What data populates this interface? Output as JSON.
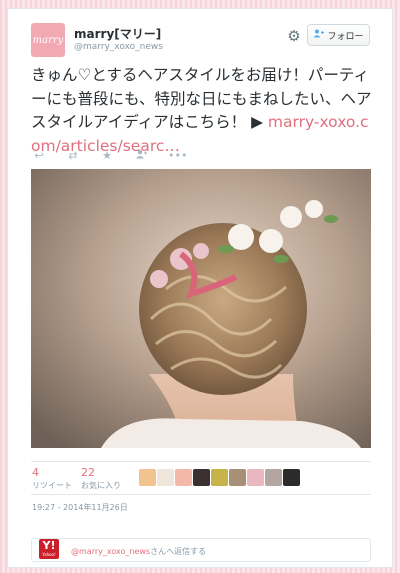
{
  "user": {
    "display_name": "marry[マリー]",
    "handle": "@marry_xoxo_news",
    "avatar_text": "marry"
  },
  "follow_button": {
    "label": "フォロー",
    "icon": "person-plus-icon"
  },
  "tweet": {
    "text": "きゅん♡とするヘアスタイルをお届け！パーティーにも普段にも、特別な日にもまねしたい、ヘアスタイルアイディアはこちら！ ▶ ",
    "link": "marry-xoxo.com/articles/searc…"
  },
  "actions": [
    "reply-icon",
    "retweet-icon",
    "favorite-icon",
    "follow-icon",
    "more-icon"
  ],
  "stats": {
    "retweets": {
      "count": "4",
      "label": "リツイート"
    },
    "favorites": {
      "count": "22",
      "label": "お気に入り"
    }
  },
  "timestamp": "19:27 - 2014年11月26日",
  "reply": {
    "logo_text": "Y!",
    "logo_subtext": "Yahoo!",
    "mention": "@marry_xoxo_news",
    "suffix": "さんへ返信する"
  },
  "colors": {
    "accent": "#e0707e",
    "muted": "#8899a6"
  }
}
